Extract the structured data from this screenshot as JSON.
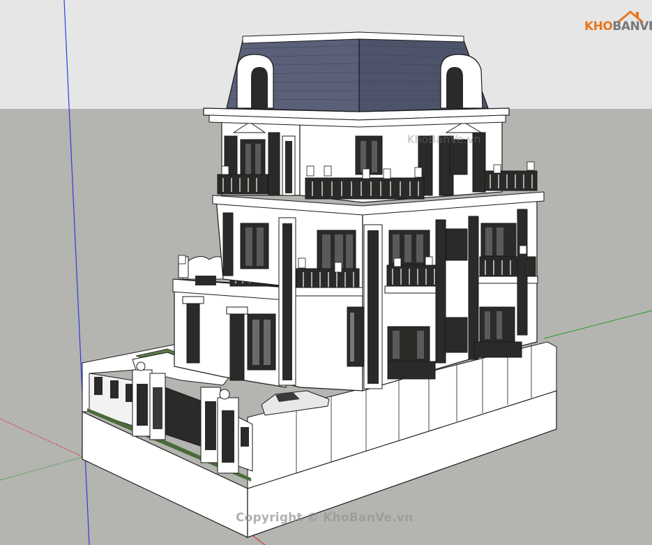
{
  "colors": {
    "sky": "#e6e6e6",
    "ground": "#b4b4b1",
    "roof": "#5a6078",
    "roof_dark": "#3d4156",
    "wall": "#ffffff",
    "trim": "#1a1a1a",
    "window": "#2c2a28",
    "grass": "#5b7a4a",
    "axis_blue": "#2c3cdc",
    "axis_red": "#d22020",
    "axis_green": "#2a9a2a",
    "logo_orange": "#e8761c",
    "logo_gray": "#777777"
  },
  "logo": {
    "text_part1": "KHO",
    "text_part2": "BANVE"
  },
  "watermarks": {
    "top": "KhoBanVe.vn",
    "bottom": "Copyright © KhoBanVe.vn"
  }
}
